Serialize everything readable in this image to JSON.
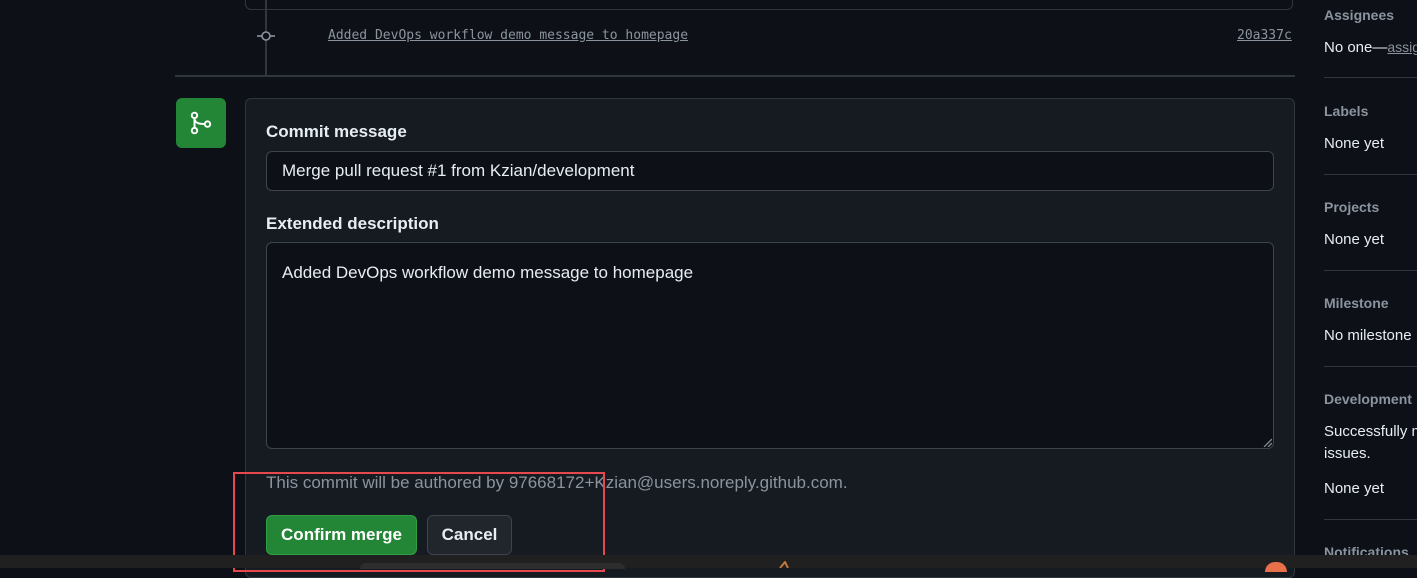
{
  "timeline": {
    "commit_message": "Added DevOps workflow demo message to homepage",
    "commit_sha": "20a337c"
  },
  "merge_form": {
    "commit_message_label": "Commit message",
    "commit_message_value": "Merge pull request #1 from Kzian/development",
    "extended_description_label": "Extended description",
    "extended_description_value": "Added DevOps workflow demo message to homepage",
    "author_note": "This commit will be authored by 97668172+Kzian@users.noreply.github.com.",
    "confirm_label": "Confirm merge",
    "cancel_label": "Cancel"
  },
  "sidebar": {
    "assignees_heading": "Assignees",
    "assignees_value": "No one—",
    "assignees_link": "assign yourself",
    "labels_heading": "Labels",
    "labels_value": "None yet",
    "projects_heading": "Projects",
    "projects_value": "None yet",
    "milestone_heading": "Milestone",
    "milestone_value": "No milestone",
    "development_heading": "Development",
    "development_text_line1": "Successfully merging this pull request may close these",
    "development_text_line2": "issues.",
    "development_value": "None yet",
    "notifications_heading": "Notifications"
  },
  "colors": {
    "background": "#0d1117",
    "panel": "#161b22",
    "border": "#30363d",
    "success": "#238636",
    "muted": "#8b949e",
    "annotation": "#e5484d"
  },
  "icons": {
    "merge_badge": "git-merge-icon",
    "commit_node": "git-commit-icon",
    "resize": "resize-grip-icon"
  }
}
